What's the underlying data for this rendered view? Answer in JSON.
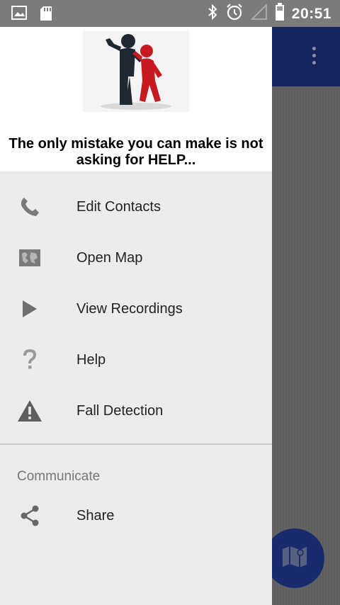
{
  "status_bar": {
    "time": "20:51",
    "icons_left": [
      "image-icon",
      "sd-card-icon"
    ],
    "icons_right": [
      "bluetooth-icon",
      "alarm-icon",
      "signal-icon",
      "battery-icon"
    ]
  },
  "drawer": {
    "tagline": "The only mistake you can make is not asking for HELP...",
    "menu_items": [
      {
        "label": "Edit Contacts",
        "icon": "phone-icon"
      },
      {
        "label": "Open Map",
        "icon": "map-icon"
      },
      {
        "label": "View Recordings",
        "icon": "play-icon"
      },
      {
        "label": "Help",
        "icon": "help-icon"
      },
      {
        "label": "Fall Detection",
        "icon": "warning-icon"
      }
    ],
    "section_title": "Communicate",
    "section_items": [
      {
        "label": "Share",
        "icon": "share-icon"
      }
    ]
  },
  "colors": {
    "toolbar": "#15235e",
    "fab": "#1a2a6e",
    "drawer_bg": "#ececec",
    "icon_gray": "#6f6f6f"
  }
}
